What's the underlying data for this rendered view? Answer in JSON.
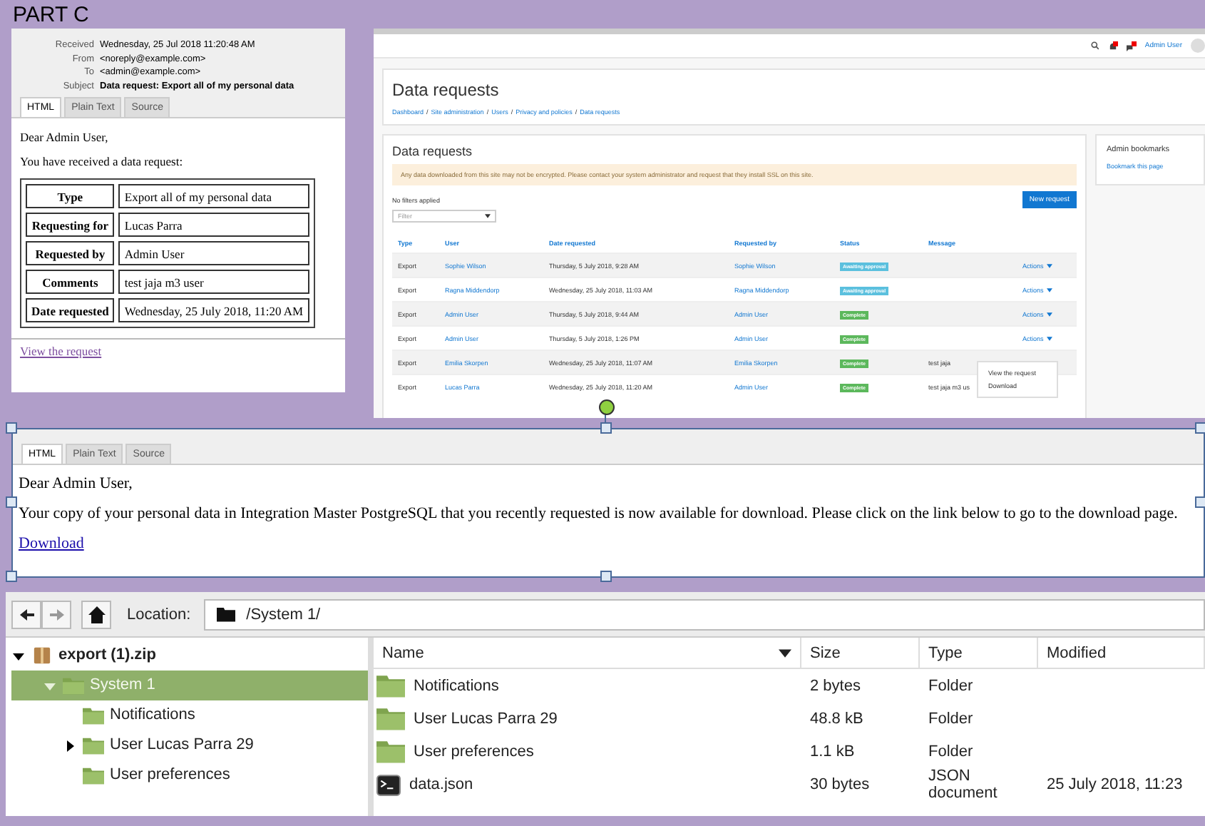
{
  "title": "PART C",
  "request_email": {
    "headers": [
      {
        "label": "Received",
        "value": "Wednesday, 25 Jul 2018 11:20:48 AM"
      },
      {
        "label": "From",
        "value": "<noreply@example.com>"
      },
      {
        "label": "To",
        "value": "<admin@example.com>"
      },
      {
        "label": "Subject",
        "value": "Data request: Export all of my personal data"
      }
    ],
    "tabs": [
      {
        "label": "HTML",
        "selected": true
      },
      {
        "label": "Plain Text",
        "selected": false
      },
      {
        "label": "Source",
        "selected": false
      }
    ],
    "greeting": "Dear Admin User,",
    "intro": "You have received a data request:",
    "details": [
      {
        "label": "Type",
        "value": "Export all of my personal data"
      },
      {
        "label": "Requesting for",
        "value": "Lucas Parra"
      },
      {
        "label": "Requested by",
        "value": "Admin User"
      },
      {
        "label": "Comments",
        "value": "test jaja m3 user"
      },
      {
        "label": "Date requested",
        "value": "Wednesday, 25 July 2018, 11:20 AM"
      }
    ],
    "link": "View the request"
  },
  "moodle": {
    "user": "Admin User",
    "page_title": "Data requests",
    "breadcrumb": {
      "separator": "/",
      "items": [
        "Dashboard",
        "Site administration",
        "Users",
        "Privacy and policies",
        "Data requests"
      ]
    },
    "section_title": "Data requests",
    "alert": "Any data downloaded from this site may not be encrypted. Please contact your system administrator and request that they install SSL on this site.",
    "filters_status": "No filters applied",
    "filter_placeholder": "Filter",
    "new_request_button": "New request",
    "columns": [
      "Type",
      "User",
      "Date requested",
      "Requested by",
      "Status",
      "Message"
    ],
    "rows": [
      {
        "type": "Export",
        "user": "Sophie Wilson",
        "date": "Thursday, 5 July 2018, 9:28 AM",
        "requested_by": "Sophie Wilson",
        "status": "Awaiting approval",
        "color": "#5bc0de",
        "actions": "Actions"
      },
      {
        "type": "Export",
        "user": "Ragna Middendorp",
        "date": "Wednesday, 25 July 2018, 11:03 AM",
        "requested_by": "Ragna Middendorp",
        "status": "Awaiting approval",
        "color": "#5bc0de",
        "actions": "Actions"
      },
      {
        "type": "Export",
        "user": "Admin User",
        "date": "Thursday, 5 July 2018, 9:44 AM",
        "requested_by": "Admin User",
        "status": "Complete",
        "color": "#5cb85c",
        "actions": "Actions"
      },
      {
        "type": "Export",
        "user": "Admin User",
        "date": "Thursday, 5 July 2018, 1:26 PM",
        "requested_by": "Admin User",
        "status": "Complete",
        "color": "#5cb85c",
        "actions": "Actions"
      },
      {
        "type": "Export",
        "user": "Emilia Skorpen",
        "date": "Wednesday, 25 July 2018, 11:07 AM",
        "requested_by": "Emilia Skorpen",
        "status": "Complete",
        "color": "#5cb85c",
        "message": "test jaja"
      },
      {
        "type": "Export",
        "user": "Lucas Parra",
        "date": "Wednesday, 25 July 2018, 11:20 AM",
        "requested_by": "Admin User",
        "status": "Complete",
        "color": "#5cb85c",
        "message": "test jaja m3 us"
      }
    ],
    "actions_menu": [
      "View the request",
      "Download"
    ],
    "bookmarks": {
      "title": "Admin bookmarks",
      "link": "Bookmark this page"
    }
  },
  "download_email": {
    "tabs": [
      {
        "label": "HTML",
        "selected": true
      },
      {
        "label": "Plain Text",
        "selected": false
      },
      {
        "label": "Source",
        "selected": false
      }
    ],
    "greeting": "Dear Admin User,",
    "body": "Your copy of your personal data in Integration Master PostgreSQL that you recently requested is now available for download. Please click on the link below to go to the download page.",
    "link": "Download"
  },
  "file_manager": {
    "location_label": "Location:",
    "path": "/System 1/",
    "tree": [
      {
        "label": "export (1).zip",
        "kind": "archive",
        "has_children": true,
        "expanded": true,
        "selected": false,
        "children": [
          {
            "label": "System 1",
            "kind": "folder",
            "has_children": true,
            "expanded": true,
            "selected": true,
            "children": [
              {
                "label": "Notifications",
                "kind": "folder",
                "has_children": false,
                "expanded": false,
                "selected": false
              },
              {
                "label": "User Lucas Parra 29",
                "kind": "folder",
                "has_children": true,
                "expanded": false,
                "selected": false
              },
              {
                "label": "User preferences",
                "kind": "folder",
                "has_children": false,
                "expanded": false,
                "selected": false
              }
            ]
          }
        ]
      }
    ],
    "columns": [
      {
        "label": "Name",
        "sorted": true
      },
      {
        "label": "Size",
        "sorted": false
      },
      {
        "label": "Type",
        "sorted": false
      },
      {
        "label": "Modified",
        "sorted": false
      }
    ],
    "files": [
      {
        "name": "Notifications",
        "kind": "folder",
        "size": "2 bytes",
        "type": "Folder"
      },
      {
        "name": "User Lucas Parra 29",
        "kind": "folder",
        "size": "48.8 kB",
        "type": "Folder"
      },
      {
        "name": "User preferences",
        "kind": "folder",
        "size": "1.1 kB",
        "type": "Folder"
      },
      {
        "name": "data.json",
        "kind": "script",
        "size": "30 bytes",
        "type": "JSON document",
        "modified": "25 July 2018, 11:23"
      }
    ]
  }
}
